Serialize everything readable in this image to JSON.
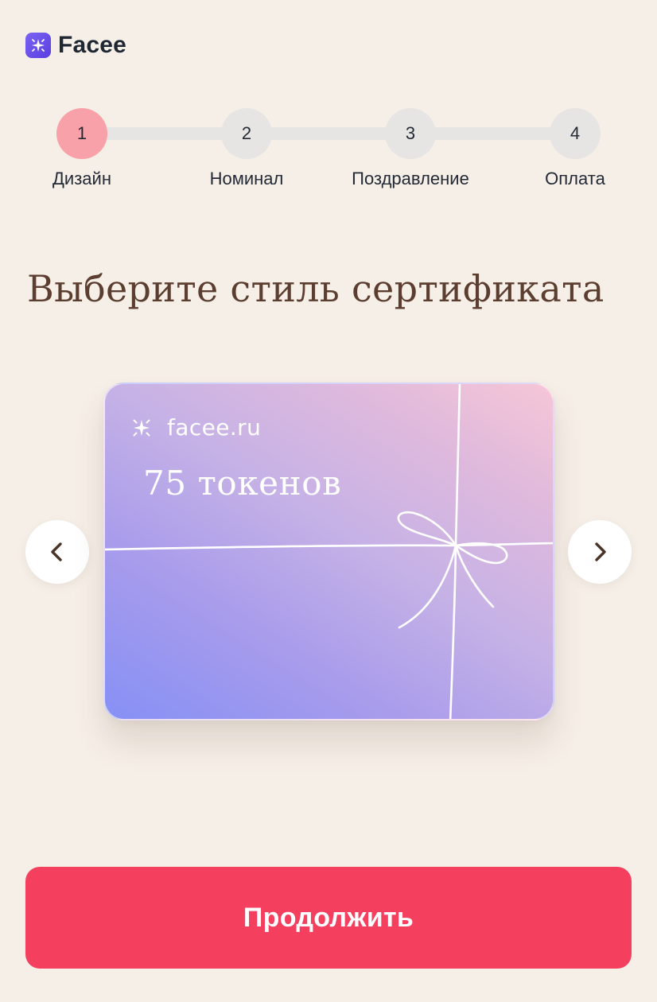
{
  "header": {
    "logo_icon": "sparkle-icon",
    "app_name": "Facee",
    "brand_color": "#6246ea"
  },
  "stepper": {
    "current_step": 1,
    "steps": [
      {
        "number": "1",
        "label": "Дизайн"
      },
      {
        "number": "2",
        "label": "Номинал"
      },
      {
        "number": "3",
        "label": "Поздравление"
      },
      {
        "number": "4",
        "label": "Оплата"
      }
    ],
    "active_color": "#f9a1a8",
    "inactive_color": "#e6e5e3"
  },
  "main": {
    "title": "Выберите стиль сертификата",
    "carousel": {
      "prev_icon": "chevron-left-icon",
      "next_icon": "chevron-right-icon",
      "card": {
        "brand_icon": "sparkle-icon",
        "brand": "facee.ru",
        "amount": "75 токенов"
      }
    }
  },
  "footer": {
    "continue_label": "Продолжить",
    "continue_color": "#f43f5f"
  }
}
